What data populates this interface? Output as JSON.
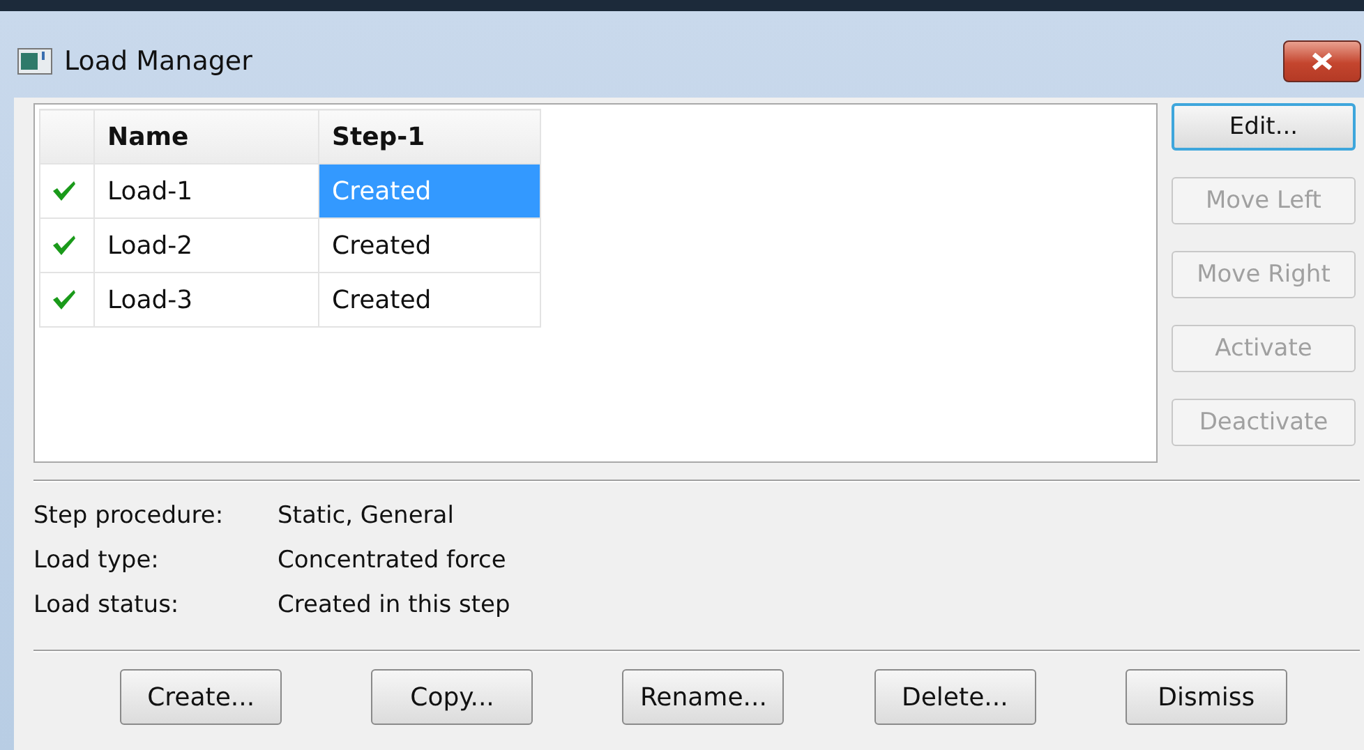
{
  "window": {
    "title": "Load Manager"
  },
  "table": {
    "columns": [
      "Name",
      "Step-1"
    ],
    "rows": [
      {
        "active": true,
        "name": "Load-1",
        "step_1": "Created",
        "selected": true
      },
      {
        "active": true,
        "name": "Load-2",
        "step_1": "Created",
        "selected": false
      },
      {
        "active": true,
        "name": "Load-3",
        "step_1": "Created",
        "selected": false
      }
    ]
  },
  "side_buttons": [
    {
      "label": "Edit...",
      "disabled": false,
      "focused": true
    },
    {
      "label": "Move Left",
      "disabled": true,
      "focused": false
    },
    {
      "label": "Move Right",
      "disabled": true,
      "focused": false
    },
    {
      "label": "Activate",
      "disabled": true,
      "focused": false
    },
    {
      "label": "Deactivate",
      "disabled": true,
      "focused": false
    }
  ],
  "details": [
    {
      "label": "Step procedure:",
      "value": "Static, General"
    },
    {
      "label": "Load type:",
      "value": "Concentrated force"
    },
    {
      "label": "Load status:",
      "value": "Created in this step"
    }
  ],
  "buttons": [
    "Create...",
    "Copy...",
    "Rename...",
    "Delete...",
    "Dismiss"
  ]
}
